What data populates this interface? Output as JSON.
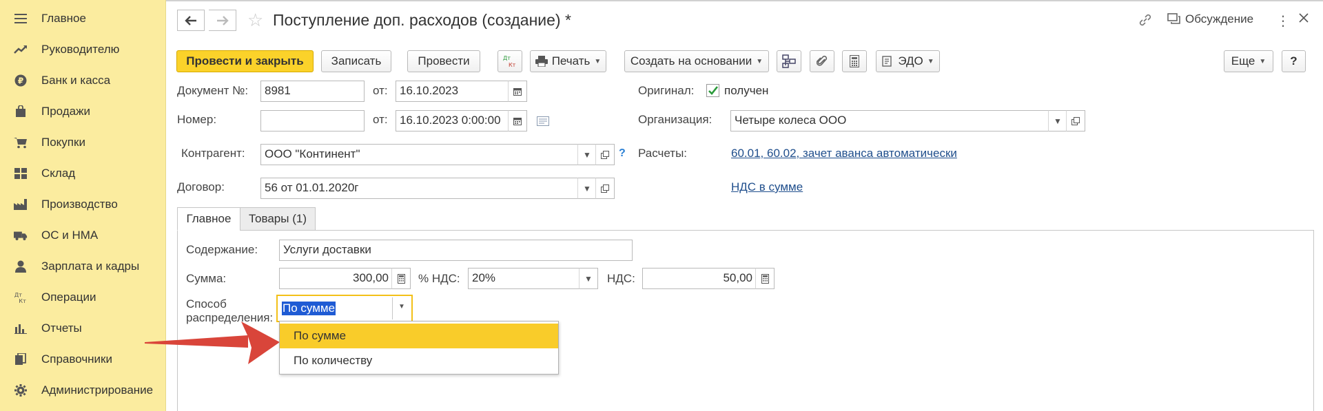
{
  "sidebar": {
    "items": [
      {
        "label": "Главное",
        "icon": "menu-lines-icon"
      },
      {
        "label": "Руководителю",
        "icon": "trend-icon"
      },
      {
        "label": "Банк и касса",
        "icon": "ruble-coin-icon"
      },
      {
        "label": "Продажи",
        "icon": "shopping-bag-icon"
      },
      {
        "label": "Покупки",
        "icon": "cart-icon"
      },
      {
        "label": "Склад",
        "icon": "warehouse-grid-icon"
      },
      {
        "label": "Производство",
        "icon": "factory-icon"
      },
      {
        "label": "ОС и НМА",
        "icon": "truck-icon"
      },
      {
        "label": "Зарплата и кадры",
        "icon": "person-icon"
      },
      {
        "label": "Операции",
        "icon": "dt-kt-icon"
      },
      {
        "label": "Отчеты",
        "icon": "bar-chart-icon"
      },
      {
        "label": "Справочники",
        "icon": "books-icon"
      },
      {
        "label": "Администрирование",
        "icon": "gear-icon"
      }
    ]
  },
  "header": {
    "title": "Поступление доп. расходов (создание) *",
    "discussion_label": "Обсуждение"
  },
  "toolbar": {
    "post_close": "Провести и закрыть",
    "save": "Записать",
    "post": "Провести",
    "dtkt": "Дт Кт",
    "print": "Печать",
    "create_based": "Создать на основании",
    "edo": "ЭДО",
    "more": "Еще",
    "help": "?"
  },
  "form": {
    "doc_no_label": "Документ №:",
    "doc_no_value": "8981",
    "from_label": "от:",
    "doc_date": "16.10.2023",
    "number_label": "Номер:",
    "number_value": "",
    "number_date": "16.10.2023  0:00:00",
    "original_label": "Оригинал:",
    "original_value": "получен",
    "org_label": "Организация:",
    "org_value": "Четыре колеса ООО",
    "contractor_label": "Контрагент:",
    "contractor_value": "ООО \"Континент\"",
    "help_q": "?",
    "settlements_label": "Расчеты:",
    "settlements_link": "60.01, 60.02, зачет аванса автоматически",
    "contract_label": "Договор:",
    "contract_value": "56 от 01.01.2020г",
    "vat_link": "НДС в сумме"
  },
  "tabs": [
    {
      "label": "Главное",
      "active": true
    },
    {
      "label": "Товары (1)",
      "active": false
    }
  ],
  "main_tab": {
    "content_label": "Содержание:",
    "content_value": "Услуги доставки",
    "sum_label": "Сумма:",
    "sum_value": "300,00",
    "vat_rate_label": "% НДС:",
    "vat_rate_value": "20%",
    "vat_label": "НДС:",
    "vat_value": "50,00",
    "distribution_label_line1": "Способ",
    "distribution_label_line2": "распределения:",
    "distribution_value": "По сумме"
  },
  "dropdown": {
    "options": [
      {
        "label": "По сумме",
        "selected": true
      },
      {
        "label": "По количеству",
        "selected": false
      }
    ]
  },
  "colors": {
    "sidebar_bg": "#fbec9f",
    "primary_button": "#fbd22a",
    "selected_option": "#f9cc2a",
    "link": "#1f4e8c",
    "arrow": "#d9453a",
    "highlight": "#1f5bd4"
  }
}
